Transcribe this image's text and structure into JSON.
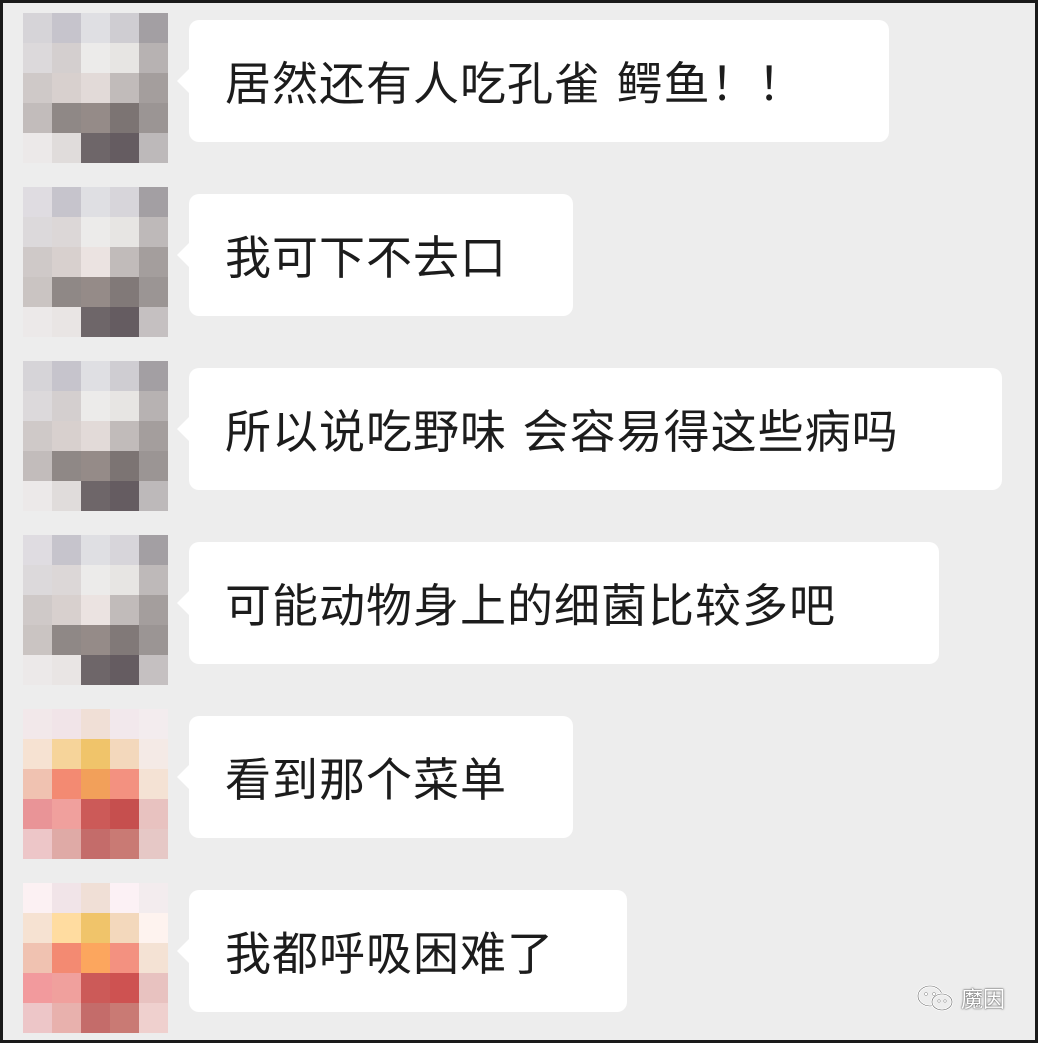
{
  "messages": [
    {
      "text": "居然还有人吃孔雀 鳄鱼！！",
      "avatar": "gray"
    },
    {
      "text": "我可下不去口",
      "avatar": "gray"
    },
    {
      "text": "所以说吃野味 会容易得这些病吗",
      "avatar": "gray"
    },
    {
      "text": "可能动物身上的细菌比较多吧",
      "avatar": "gray"
    },
    {
      "text": "看到那个菜单",
      "avatar": "warm"
    },
    {
      "text": "我都呼吸困难了",
      "avatar": "warm"
    }
  ],
  "watermark": {
    "text": "魔因",
    "icon": "wechat-icon"
  },
  "colors": {
    "background": "#ededed",
    "bubble": "#ffffff",
    "text": "#1c1c1c",
    "border": "#1a1a1a"
  },
  "avatar_palettes": {
    "gray": [
      "#d6d4d8",
      "#c6c4cc",
      "#dfdfe3",
      "#cfcdd2",
      "#a39fa3",
      "#dcd9db",
      "#d4cfcf",
      "#ecebea",
      "#e7e5e3",
      "#b7b2b2",
      "#cfc9c8",
      "#d8d0ce",
      "#e2dad8",
      "#c1bbba",
      "#a49e9d",
      "#c2bcbb",
      "#8f8886",
      "#958b88",
      "#7c7473",
      "#9b9594",
      "#ece9e9",
      "#e0dcdb",
      "#6e6669",
      "#655c61",
      "#bdb9ba"
    ],
    "warm": [
      "#f2e8ea",
      "#f1e4e8",
      "#f0dfd6",
      "#f2e8ec",
      "#f3ecee",
      "#f6e2d2",
      "#f6d49a",
      "#f0c46a",
      "#f3d8bc",
      "#f4eae6",
      "#f0c2b1",
      "#f38a72",
      "#f2a05a",
      "#f39180",
      "#f4e2d4",
      "#e99497",
      "#f0a09d",
      "#cc5a58",
      "#c64f4e",
      "#e8c2c0",
      "#edc6c8",
      "#dfaaa6",
      "#c46c6a",
      "#c97a74",
      "#e6c8c6"
    ]
  }
}
